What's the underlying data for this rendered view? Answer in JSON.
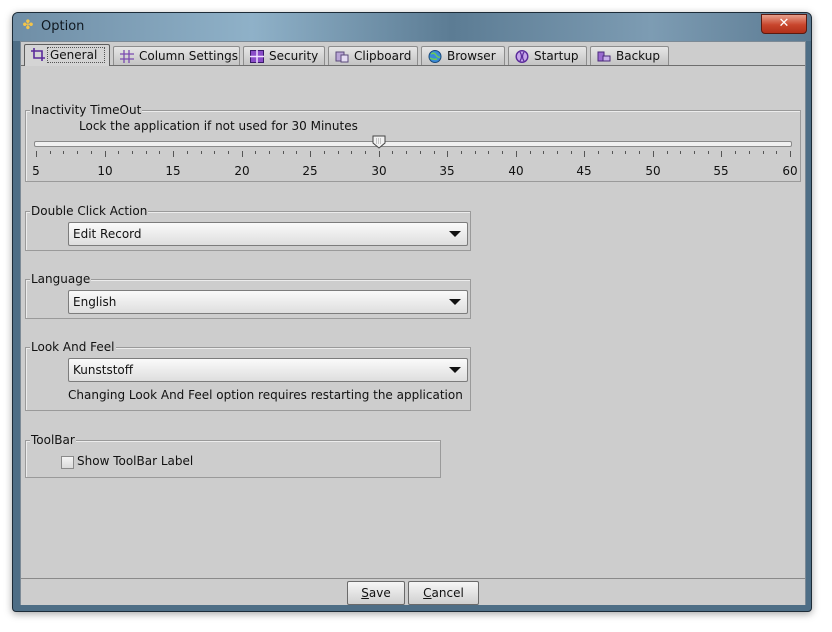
{
  "window": {
    "title": "Option",
    "close_label": "✕"
  },
  "tabs": [
    {
      "label": "General",
      "icon": "crop-icon",
      "active": true
    },
    {
      "label": "Column Settings",
      "icon": "grid-icon"
    },
    {
      "label": "Security",
      "icon": "security-icon"
    },
    {
      "label": "Clipboard",
      "icon": "clipboard-icon"
    },
    {
      "label": "Browser",
      "icon": "globe-icon"
    },
    {
      "label": "Startup",
      "icon": "startup-icon"
    },
    {
      "label": "Backup",
      "icon": "backup-icon"
    }
  ],
  "inactivity": {
    "legend": "Inactivity TimeOut",
    "label": "Lock the application if not used for 30 Minutes",
    "min": 5,
    "max": 60,
    "value": 30,
    "tick_labels": [
      "5",
      "10",
      "15",
      "20",
      "25",
      "30",
      "35",
      "40",
      "45",
      "50",
      "55",
      "60"
    ]
  },
  "double_click": {
    "legend": "Double Click Action",
    "value": "Edit Record"
  },
  "language": {
    "legend": "Language",
    "value": "English"
  },
  "look_and_feel": {
    "legend": "Look And Feel",
    "value": "Kunststoff",
    "note": "Changing Look And Feel option requires restarting the application"
  },
  "toolbar": {
    "legend": "ToolBar",
    "checkbox_label": "Show ToolBar Label",
    "checked": false
  },
  "buttons": {
    "save_first": "S",
    "save_rest": "ave",
    "cancel_first": "C",
    "cancel_rest": "ancel"
  }
}
